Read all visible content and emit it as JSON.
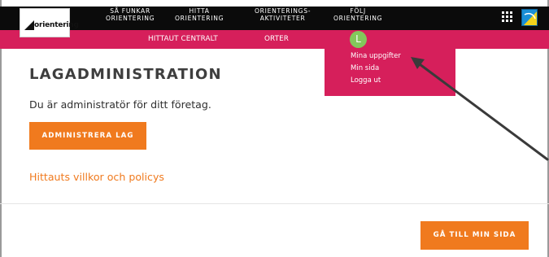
{
  "colors": {
    "topbar": "#0b0b0b",
    "brand_pink": "#d61f5b",
    "accent_orange": "#f07a1e",
    "avatar_green": "#83c75b"
  },
  "logo": {
    "text": "orientering",
    "icon": "triangle-logo-icon"
  },
  "top_nav": [
    {
      "line1": "SÅ FUNKAR",
      "line2": "ORIENTERING"
    },
    {
      "line1": "HITTA",
      "line2": "ORIENTERING"
    },
    {
      "line1": "ORIENTERINGS-",
      "line2": "AKTIVITETER"
    },
    {
      "line1": "FÖLJ",
      "line2": "ORIENTERING"
    }
  ],
  "top_icons": [
    "grid-menu-icon",
    "brand-logo-icon"
  ],
  "sub_nav": {
    "items": [
      "HITTAUT CENTRALT",
      "ORTER"
    ],
    "avatar_letter": "L"
  },
  "user_menu": {
    "items": [
      "Mina uppgifter",
      "Min sida",
      "Logga ut"
    ]
  },
  "main": {
    "title": "LAGADMINISTRATION",
    "admin_text": "Du är administratör för ditt företag.",
    "admin_button": "ADMINISTRERA LAG",
    "policy_link": "Hittauts villkor och policys"
  },
  "footer": {
    "my_page_button": "GÅ TILL MIN SIDA"
  }
}
